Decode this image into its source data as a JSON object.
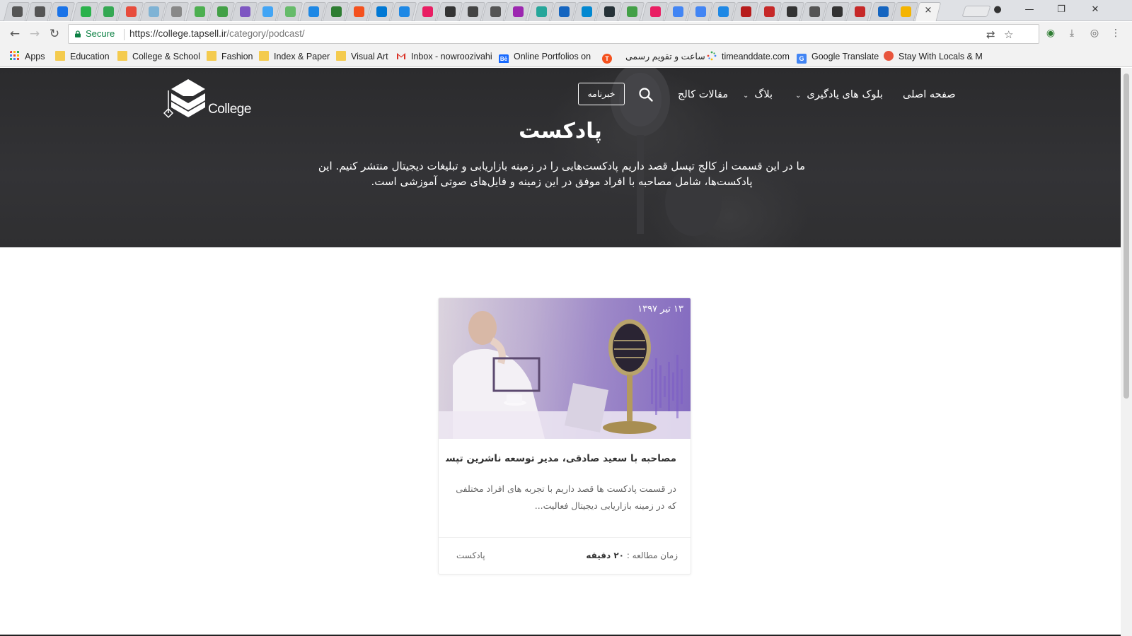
{
  "browser": {
    "tab_favicon_colors": [
      "#555",
      "#555",
      "#1a73e8",
      "#2bb24c",
      "#34a853",
      "#e74c3c",
      "#7fb3d5",
      "#888",
      "#4caf50",
      "#43a047",
      "#7e57c2",
      "#42a5f5",
      "#66bb6a",
      "#1e88e5",
      "#2e7d32",
      "#f4511e",
      "#0078d4",
      "#1e88e5",
      "#e91e63",
      "#333",
      "#444",
      "#555",
      "#9c27b0",
      "#26a69a",
      "#1565c0",
      "#0288d1",
      "#263238",
      "#43a047",
      "#e91e63",
      "#4285f4",
      "#4285f4",
      "#1e88e5",
      "#b71c1c",
      "#c62828",
      "#333",
      "#555",
      "#333",
      "#c62828",
      "#1565c0",
      "#f4b400"
    ],
    "active_tab_close": "×",
    "window_controls": {
      "account": "●",
      "minimize": "—",
      "restore": "❐",
      "close": "✕"
    },
    "nav": {
      "back": "←",
      "forward": "→",
      "reload": "↻"
    },
    "security_label": "Secure",
    "url_host": "https://college.tapsell.ir",
    "url_path": "/category/podcast/",
    "omnibox_icons": {
      "translate": "⇄",
      "bookmark_star": "☆"
    },
    "extensions": [
      "◉",
      "⤓",
      "◎",
      "⋮"
    ],
    "bookmarks": [
      {
        "label": "Apps",
        "icon": "apps-grid-icon",
        "color": "#ea4335"
      },
      {
        "label": "Education",
        "icon": "folder-icon",
        "color": "#f4cb4e"
      },
      {
        "label": "College & School",
        "icon": "folder-icon",
        "color": "#f4cb4e"
      },
      {
        "label": "Fashion",
        "icon": "folder-icon",
        "color": "#f4cb4e"
      },
      {
        "label": "Index & Paper",
        "icon": "folder-icon",
        "color": "#f4cb4e"
      },
      {
        "label": "Visual Art",
        "icon": "folder-icon",
        "color": "#f4cb4e"
      },
      {
        "label": "Inbox - nowroozivahi",
        "icon": "gmail-icon",
        "color": "#d93025"
      },
      {
        "label": "Online Portfolios on",
        "icon": "behance-icon",
        "color": "#1769ff"
      },
      {
        "label": "",
        "icon": "t-badge-icon",
        "color": "#f4511e"
      },
      {
        "label": "ساعت و تقویم رسمی",
        "icon": "",
        "color": ""
      },
      {
        "label": "timeanddate.com",
        "icon": "timeanddate-icon",
        "color": "#34a853"
      },
      {
        "label": "Google Translate",
        "icon": "translate-icon",
        "color": "#4285f4"
      },
      {
        "label": "Stay With Locals & M",
        "icon": "globe-icon",
        "color": "#e8553d"
      }
    ]
  },
  "site": {
    "logo_word": "College",
    "nav": {
      "home": "صفحه اصلی",
      "learning_blocks": "بلوک های یادگیری",
      "blog": "بلاگ",
      "articles": "مقالات کالج",
      "newsletter": "خبرنامه",
      "chevron": "⌄"
    },
    "hero": {
      "title": "پادکست",
      "description": "ما در این قسمت از کالج تپسل قصد داریم پادکست‌هایی را در زمینه بازاریابی و تبلیغات دیجیتال منتشر کنیم. این پادکست‌ها، شامل مصاحبه با افراد موفق در این زمینه و فایل‌های صوتی آموزشی است."
    },
    "post": {
      "date": "۱۳ تیر ۱۳۹۷",
      "title": "مصاحبه با سعید صادقی، مدیر توسعه ناشرین تپسل – اول ...",
      "excerpt": "در قسمت پادکست ها قصد داریم با تجربه های افراد مختلفی که در زمینه بازاریابی دیجیتال فعالیت...",
      "read_time_label": "زمان مطالعه :",
      "read_time_value": "۲۰ دقیقه",
      "category": "پادکست"
    }
  }
}
